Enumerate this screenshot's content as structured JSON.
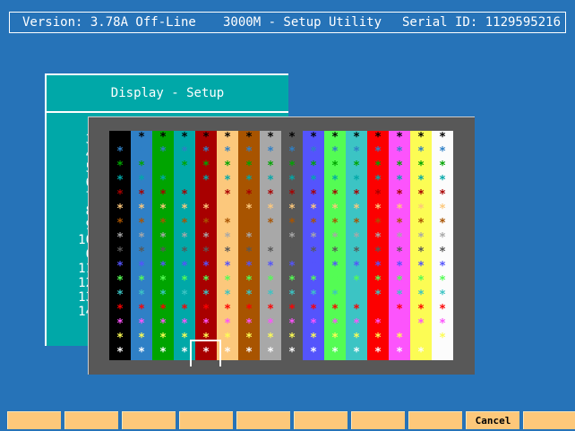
{
  "title_bar": {
    "version": "Version: 3.78A Off-Line",
    "utility": "3000M - Setup Utility",
    "serial": "Serial ID: 1129595216"
  },
  "setup_window": {
    "title": "Display - Setup",
    "row_numbers": [
      "3",
      "4",
      "5",
      "6",
      "7",
      "8",
      "9",
      "10",
      "0",
      "11",
      "12",
      "13",
      "14"
    ]
  },
  "palette": {
    "background_colors": [
      "#000000",
      "#2f80c6",
      "#00a400",
      "#00a8a8",
      "#a80000",
      "#fcc87c",
      "#a85400",
      "#a8a8a8",
      "#585858",
      "#5454fc",
      "#54fc54",
      "#3cc4c4",
      "#fc0000",
      "#fc54fc",
      "#fcfc54",
      "#fcfcfc"
    ],
    "symbol": "*",
    "row_symbol_colors": [
      "#000000",
      "#2f80c6",
      "#00a400",
      "#00a8a8",
      "#a80000",
      "#fcc87c",
      "#a85400",
      "#a8a8a8",
      "#585858",
      "#5454fc",
      "#54fc54",
      "#3cc4c4",
      "#fc0000",
      "#fc54fc",
      "#fcfc54",
      "#fcfcfc"
    ],
    "selected": {
      "row": 15,
      "column": 4
    }
  },
  "function_keys": [
    "",
    "",
    "",
    "",
    "",
    "",
    "",
    "",
    "Cancel",
    ""
  ]
}
